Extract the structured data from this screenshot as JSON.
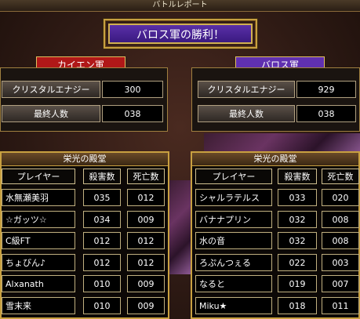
{
  "topbar": {
    "title": "バトルレポート"
  },
  "result": {
    "text": "バロス軍の勝利！"
  },
  "armies": {
    "left": {
      "name": "カイエン軍",
      "color": "#b01818",
      "stats": [
        {
          "label": "クリスタルエナジー",
          "value": "300"
        },
        {
          "label": "最終人数",
          "value": "038"
        }
      ]
    },
    "right": {
      "name": "バロス軍",
      "color": "#6030b0",
      "stats": [
        {
          "label": "クリスタルエナジー",
          "value": "929"
        },
        {
          "label": "最終人数",
          "value": "038"
        }
      ]
    }
  },
  "halls": {
    "left": {
      "title": "栄光の殿堂",
      "headers": {
        "player": "プレイヤー",
        "kills": "殺害数",
        "deaths": "死亡数"
      },
      "rows": [
        {
          "name": "水無瀬美羽",
          "kills": "035",
          "deaths": "012"
        },
        {
          "name": "☆ガッツ☆",
          "kills": "034",
          "deaths": "009"
        },
        {
          "name": "C級FT",
          "kills": "012",
          "deaths": "012"
        },
        {
          "name": "ちょびん♪",
          "kills": "012",
          "deaths": "012"
        },
        {
          "name": "Alxanath",
          "kills": "010",
          "deaths": "009"
        },
        {
          "name": "雪末来",
          "kills": "010",
          "deaths": "009"
        }
      ]
    },
    "right": {
      "title": "栄光の殿堂",
      "headers": {
        "player": "プレイヤー",
        "kills": "殺害数",
        "deaths": "死亡数"
      },
      "rows": [
        {
          "name": "シャルラテルス",
          "kills": "033",
          "deaths": "020"
        },
        {
          "name": "バナナプリン",
          "kills": "032",
          "deaths": "008"
        },
        {
          "name": "水の音",
          "kills": "032",
          "deaths": "008"
        },
        {
          "name": "ろぷんつぇる",
          "kills": "022",
          "deaths": "003"
        },
        {
          "name": "なると",
          "kills": "019",
          "deaths": "007"
        },
        {
          "name": "Miku★",
          "kills": "018",
          "deaths": "011"
        }
      ]
    }
  }
}
